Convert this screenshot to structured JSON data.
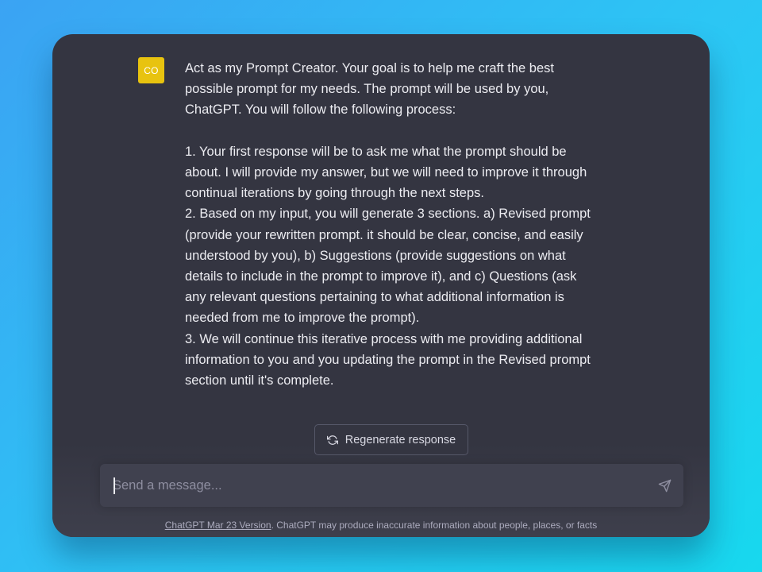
{
  "conversation": {
    "user_avatar_text": "CO",
    "user_message": "Act as my Prompt Creator. Your goal is to help me craft the best possible prompt for my needs. The prompt will be used by you, ChatGPT. You will follow the following process:\n\n1. Your first response will be to ask me what the prompt should be about. I will provide my answer, but we will need to improve it through continual iterations by going through the next steps.\n2. Based on my input, you will generate 3 sections. a) Revised prompt (provide your rewritten prompt. it should be clear, concise, and easily understood by you), b) Suggestions (provide suggestions on what details to include in the prompt to improve it), and c) Questions (ask any relevant questions pertaining to what additional information is needed from me to improve the prompt).\n3. We will continue this iterative process with me providing additional information to you and you updating the prompt in the Revised prompt section until it's complete."
  },
  "controls": {
    "regenerate_label": "Regenerate response",
    "regenerate_icon": "refresh-icon",
    "input_placeholder": "Send a message...",
    "input_value": "",
    "send_icon": "paper-plane-icon"
  },
  "footer": {
    "version_link": "ChatGPT Mar 23 Version",
    "disclaimer": ". ChatGPT may produce inaccurate information about people, places, or facts"
  },
  "colors": {
    "avatar_bg": "#e8c30f",
    "window_bg": "#343541",
    "input_bg": "#40414f"
  }
}
